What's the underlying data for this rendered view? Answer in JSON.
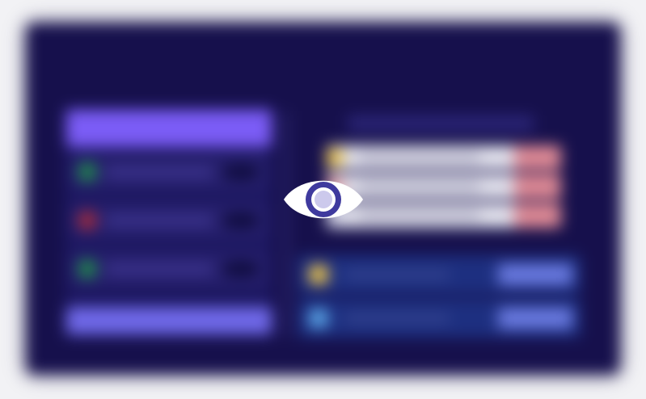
{
  "screen": {
    "title": "",
    "state": "content-hidden-blurred"
  },
  "colors": {
    "backdrop": "#f2f2f5",
    "frame": "#16104c",
    "accent_purple": "#7b5cf6",
    "footer_button": "#6f68e8",
    "status_red": "#df8a95",
    "action_card": "#1d2f80",
    "action_button": "#6a7ae0"
  },
  "left_panel": {
    "rows": [
      {
        "dot_color": "#1f8a4a"
      },
      {
        "dot_color": "#a22a3c"
      },
      {
        "dot_color": "#1f8a4a"
      }
    ]
  },
  "right_panel": {
    "list_rows": [
      {
        "badge_color": "#e9c24a"
      },
      {
        "badge_color": "#f2a8a8"
      },
      {
        "badge_color": "#cfcfe4"
      }
    ],
    "action_cards": [
      {
        "icon_color": "#e9c24a",
        "icon": "pencil-icon"
      },
      {
        "icon_color": "#5aa4e6",
        "icon": "chat-icon"
      }
    ]
  },
  "overlay": {
    "icon": "eye-icon",
    "icon_color": "#3f3a9e"
  }
}
